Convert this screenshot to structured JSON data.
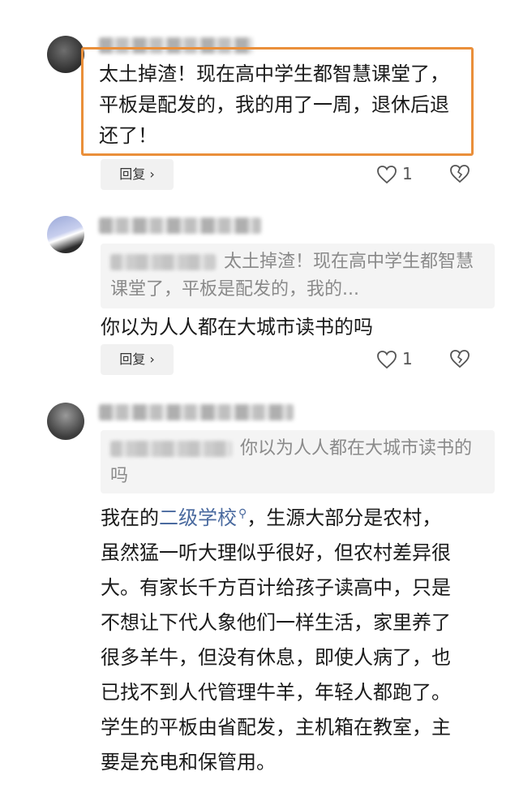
{
  "comments": [
    {
      "text": "太土掉渣！现在高中学生都智慧课堂了，平板是配发的，我的用了一周，退休后退还了！",
      "reply_label": "回复",
      "like_count": "1"
    },
    {
      "quote_text": "太土掉渣！现在高中学生都智慧课堂了，平板是配发的，我的...",
      "text": "你以为人人都在大城市读书的吗",
      "reply_label": "回复",
      "like_count": "1"
    },
    {
      "quote_text": "你以为人人都在大城市读书的吗",
      "text_before_link": "我在的",
      "link_text": "二级学校",
      "text_after_link": "，生源大部分是农村，虽然猛一听大理似乎很好，但农村差异很大。有家长千方百计给孩子读高中，只是不想让下代人象他们一样生活，家里养了很多羊牛，但没有休息，即使人病了，也已找不到人代管理牛羊，年轻人都跑了。学生的平板由省配发，主机箱在教室，主要是充电和保管用。"
    }
  ],
  "colors": {
    "highlight": "#ea8f3a",
    "link": "#4a6a9f"
  }
}
